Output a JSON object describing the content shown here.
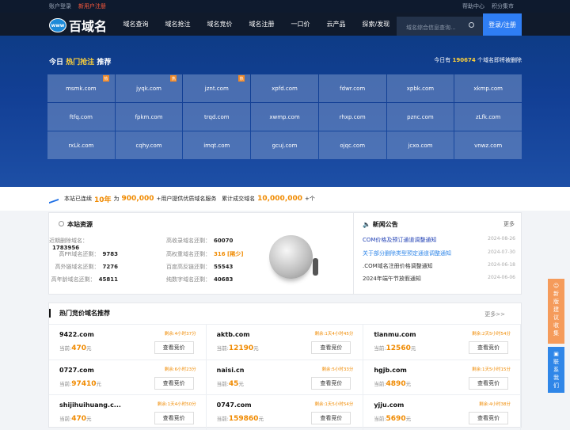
{
  "topbar": {
    "login": "账户登录",
    "register": "新用户注册",
    "help": "帮助中心",
    "points": "积分集市"
  },
  "nav": {
    "logo": "百域名",
    "logo_badge": "www",
    "items": [
      "域名查询",
      "域名抢注",
      "域名竞价",
      "域名注册",
      "一口价",
      "云产品",
      "探索/发现"
    ],
    "search_placeholder": "域名综合信息查询...",
    "login_button": "登录/注册"
  },
  "hero": {
    "prefix": "今日",
    "hot": "热门抢注",
    "suffix": "推荐",
    "right_prefix": "今日有",
    "count": "190674",
    "right_suffix": "个域名即将被删除",
    "hot_label": "热",
    "domains": [
      "msmk.com",
      "jyqk.com",
      "jznt.com",
      "xpfd.com",
      "fdwr.com",
      "xpbk.com",
      "xkmp.com",
      "ftfq.com",
      "fpkm.com",
      "trqd.com",
      "xwmp.com",
      "rhxp.com",
      "pznc.com",
      "zLfk.com",
      "rxLk.com",
      "cqhy.com",
      "imqt.com",
      "gcuj.com",
      "ojqc.com",
      "jcxo.com",
      "vnwz.com"
    ]
  },
  "stats": {
    "text1": "本站已连续",
    "years": "10年",
    "text2": "为",
    "users": "900,000",
    "text3": "+用户提供优质域名服务",
    "text4": "累计成交域名",
    "deals": "10,000,000",
    "text5": "+个"
  },
  "resources": {
    "title": "本站资源",
    "left": [
      {
        "label": "近期删除域名：",
        "value": "1783956"
      },
      {
        "label": "高PR域名还剩：",
        "value": "9783"
      },
      {
        "label": "高外链域名还剩：",
        "value": "7276"
      },
      {
        "label": "高年龄域名还剩：",
        "value": "45811"
      }
    ],
    "right": [
      {
        "label": "高收录域名还剩：",
        "value": "60070"
      },
      {
        "label": "高权重域名还剩：",
        "value": "316 [稀少]"
      },
      {
        "label": "百度高反链还剩：",
        "value": "55543"
      },
      {
        "label": "纯数字域名还剩：",
        "value": "40683"
      }
    ]
  },
  "news": {
    "title": "新闻公告",
    "more": "更多",
    "items": [
      {
        "title": "COM价格及预订通道调整通知",
        "date": "2024-08-26",
        "color": "#1f3fb4"
      },
      {
        "title": "关于部分删除类型预定通道调整通知",
        "date": "2024-07-30",
        "color": "#2f86e8"
      },
      {
        "title": ".COM域名注册价格调整通知",
        "date": "2024-06-18",
        "color": "#333"
      },
      {
        "title": "2024年端午节放假通知",
        "date": "2024-06-06",
        "color": "#333"
      }
    ]
  },
  "bids": {
    "title": "热门竞价域名推荐",
    "more": "更多>>",
    "price_label": "当前:",
    "unit": "元",
    "button": "查看竞价",
    "items": [
      {
        "name": "9422.com",
        "time": "剩余:4小时37分",
        "price": "470"
      },
      {
        "name": "aktb.com",
        "time": "剩余:1天4小时45分",
        "price": "12190"
      },
      {
        "name": "tianmu.com",
        "time": "剩余:2天5小时54分",
        "price": "12560"
      },
      {
        "name": "0727.com",
        "time": "剩余:6小时23分",
        "price": "97410"
      },
      {
        "name": "naisi.cn",
        "time": "剩余:5小时33分",
        "price": "45"
      },
      {
        "name": "hgjb.com",
        "time": "剩余:1天5小时15分",
        "price": "4890"
      },
      {
        "name": "shijihuihuang.c...",
        "time": "剩余:1天4小时50分",
        "price": "470"
      },
      {
        "name": "0747.com",
        "time": "剩余:1天5小时54分",
        "price": "159860"
      },
      {
        "name": "yjju.com",
        "time": "剩余:4小时38分",
        "price": "5690"
      }
    ]
  },
  "side": {
    "suggest": "新版建议收集",
    "contact": "联系我们"
  }
}
